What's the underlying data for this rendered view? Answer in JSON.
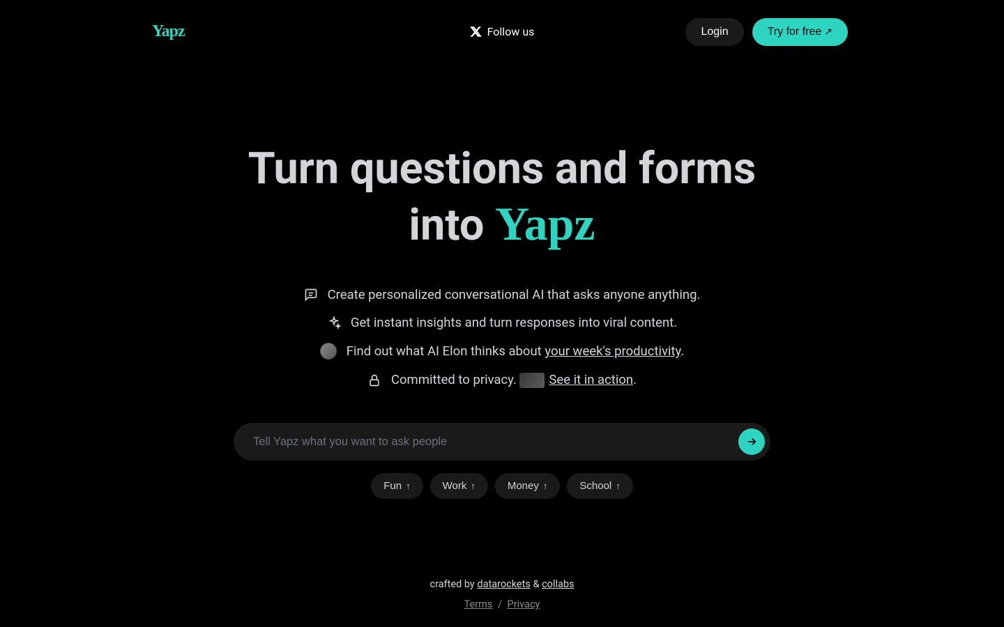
{
  "header": {
    "logo": "Yapz",
    "follow": "Follow us",
    "login": "Login",
    "try": "Try for free"
  },
  "hero": {
    "title_line1": "Turn questions and forms",
    "title_line2_prefix": "into ",
    "title_brand": "Yapz"
  },
  "features": [
    {
      "text": "Create personalized conversational AI that asks anyone anything."
    },
    {
      "text": "Get instant insights and turn responses into viral content."
    },
    {
      "prefix": "Find out what AI Elon thinks about ",
      "link": "your week's productivity",
      "suffix": "."
    },
    {
      "prefix": "Committed to privacy. ",
      "link": "See it in action",
      "suffix": "."
    }
  ],
  "input": {
    "placeholder": "Tell Yapz what you want to ask people"
  },
  "chips": [
    "Fun",
    "Work",
    "Money",
    "School"
  ],
  "footer": {
    "crafted": "crafted by ",
    "org1": "datarockets",
    "amp": " & ",
    "org2": "collabs",
    "terms": "Terms",
    "sep": " / ",
    "privacy": "Privacy"
  }
}
